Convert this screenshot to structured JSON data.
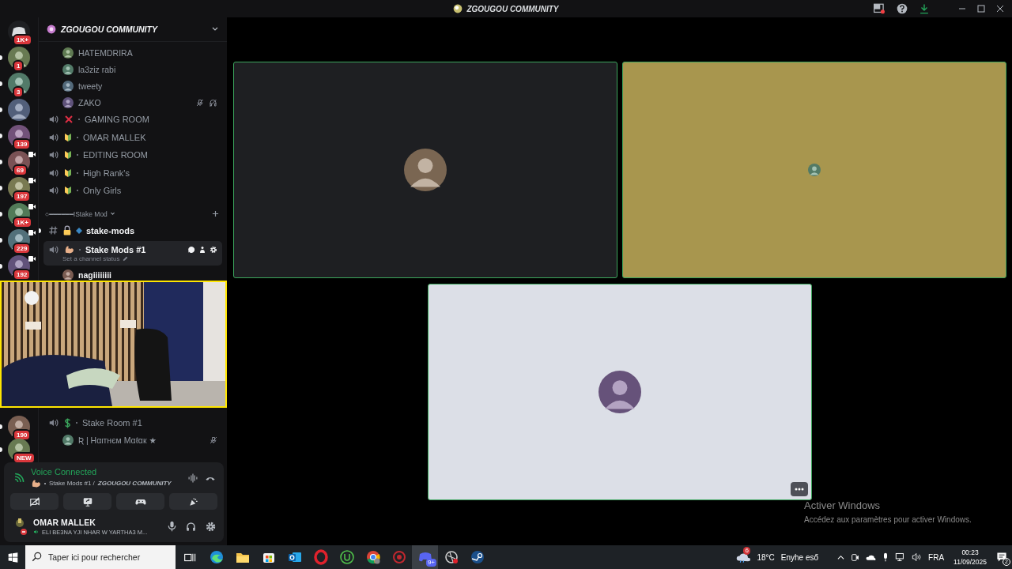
{
  "titlebar": {
    "title": "ZGOUGOU COMMUNITY"
  },
  "rail_top": [
    {
      "kind": "home",
      "badge": "1K+",
      "unread": false,
      "video": false
    },
    {
      "kind": "server",
      "badge": "1",
      "unread": true,
      "video": false
    },
    {
      "kind": "server",
      "badge": "3",
      "unread": true,
      "video": false
    },
    {
      "kind": "server",
      "unread": true,
      "video": false
    },
    {
      "kind": "server",
      "badge": "139",
      "unread": true,
      "video": false
    },
    {
      "kind": "server",
      "badge": "69",
      "unread": true,
      "video": true
    },
    {
      "kind": "server",
      "badge": "197",
      "unread": true,
      "video": true
    },
    {
      "kind": "server",
      "badge": "1K+",
      "unread": true,
      "video": true
    },
    {
      "kind": "server",
      "badge": "229",
      "unread": true,
      "video": true
    },
    {
      "kind": "server",
      "badge": "192",
      "unread": true,
      "video": true
    }
  ],
  "server_header": {
    "name": "ZGOUGOU COMMUNITY"
  },
  "channels_top": [
    {
      "kind": "member",
      "name": "HATEMDRIRA",
      "highlighted": false,
      "muted": false,
      "deafened": false
    },
    {
      "kind": "member",
      "name": "la3ziz rabi",
      "highlighted": false,
      "muted": false,
      "deafened": false
    },
    {
      "kind": "member",
      "name": "tweety",
      "highlighted": false,
      "muted": false,
      "deafened": false
    },
    {
      "kind": "member",
      "name": "ZAKO",
      "highlighted": false,
      "muted": true,
      "deafened": true
    },
    {
      "kind": "cross-voice",
      "name": "GAMING ROOM",
      "selected": false
    },
    {
      "kind": "leaf-voice",
      "name": "OMAR MALLEK",
      "selected": false
    },
    {
      "kind": "leaf-voice",
      "name": "EDITING ROOM",
      "selected": false
    },
    {
      "kind": "leaf-voice",
      "name": "High Rank's",
      "selected": false
    },
    {
      "kind": "leaf-voice",
      "name": "Only Girls",
      "selected": false
    },
    {
      "kind": "category",
      "name": "○━━━━━━IStake Mod"
    },
    {
      "kind": "text",
      "name": "stake-mods",
      "unread": true
    },
    {
      "kind": "arm-voice",
      "name": "Stake Mods #1",
      "selected": true,
      "status": "Set a channel status"
    },
    {
      "kind": "member",
      "name": "nagiiiiiiii",
      "highlighted": true,
      "muted": false,
      "deafened": false
    }
  ],
  "rail_bottom": [
    {
      "kind": "server",
      "badge": "190",
      "unread": true,
      "video": false
    },
    {
      "kind": "server",
      "badge": "NEW",
      "unread": true,
      "video": false
    }
  ],
  "channels_bottom": [
    {
      "kind": "dollar-voice",
      "name": "Stake Room #1",
      "selected": false
    },
    {
      "kind": "member",
      "name": "Ʀ | Hαιтнєм Mαℓαк ★",
      "highlighted": false,
      "muted": true,
      "deafened": false
    }
  ],
  "voice_panel": {
    "status": "Voice Connected",
    "channel": "Stake Mods #1 /",
    "server": "ZGOUGOU COMMUNITY",
    "buttons": [
      {
        "kind": "camera-off"
      },
      {
        "kind": "screen"
      },
      {
        "kind": "gamepad"
      },
      {
        "kind": "soundboard"
      }
    ],
    "user": {
      "name": "OMAR MALLEK",
      "status": "ELI BE3NA YJI NHAR W YARTHA3 M..."
    }
  },
  "stage": {
    "tiles": [
      {
        "color": "#1e1f22",
        "speaking": true,
        "more": false
      },
      {
        "color": "#a8964e",
        "speaking": true,
        "more": false
      },
      {
        "color": "#dcdfe7",
        "speaking": true,
        "more": true
      }
    ]
  },
  "activation": {
    "title": "Activer Windows",
    "text": "Accédez aux paramètres pour activer Windows."
  },
  "taskbar": {
    "search_placeholder": "Taper ici pour rechercher",
    "apps": [
      {
        "kind": "browser",
        "selected": false
      },
      {
        "kind": "folder",
        "selected": false
      },
      {
        "kind": "store",
        "selected": false
      },
      {
        "kind": "mail",
        "selected": false
      },
      {
        "kind": "ring",
        "selected": false
      },
      {
        "kind": "torrent",
        "selected": false
      },
      {
        "kind": "chrome",
        "selected": false
      },
      {
        "kind": "target",
        "selected": false
      },
      {
        "kind": "chat",
        "selected": true,
        "badge": "9+"
      },
      {
        "kind": "orb",
        "selected": false
      },
      {
        "kind": "steam",
        "selected": false
      }
    ],
    "weather": {
      "badge": "6",
      "temperature": "18°C",
      "text": "Enyhe eső"
    },
    "language": "FRA",
    "time": "00:23",
    "date": "11/09/2025",
    "notifications": "2"
  }
}
